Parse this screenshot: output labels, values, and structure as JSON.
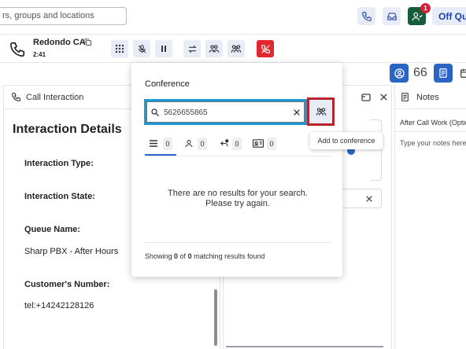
{
  "topbar": {
    "search_placeholder": "rs, groups and locations",
    "notification_count": "1",
    "status_label": "Off Que"
  },
  "call": {
    "name": "Redondo CA",
    "duration": "2:41"
  },
  "toolbar": {
    "count_66": "66"
  },
  "call_interaction": {
    "header": "Call Interaction",
    "title": "Interaction Details",
    "fields": [
      {
        "label": "Interaction Type:",
        "value": ""
      },
      {
        "label": "Interaction State:",
        "value": ""
      },
      {
        "label": "Queue Name:",
        "value": "Sharp PBX - After Hours"
      },
      {
        "label": "Customer's Number:",
        "value": "tel:+14242128126"
      }
    ]
  },
  "notes": {
    "header": "Notes",
    "after_call_work": "After Call Work (Optio",
    "placeholder": "Type your notes here"
  },
  "conference": {
    "title": "Conference",
    "search_value": "5626655865",
    "add_tooltip": "Add to conference",
    "tabs": [
      {
        "icon": "list-icon",
        "count": "0"
      },
      {
        "icon": "person-icon",
        "count": "0"
      },
      {
        "icon": "call-queue-icon",
        "count": "0"
      },
      {
        "icon": "contact-card-icon",
        "count": "0"
      }
    ],
    "no_results_line1": "There are no results for your search.",
    "no_results_line2": "Please try again.",
    "footer_prefix": "Showing ",
    "footer_shown": "0",
    "footer_of": " of ",
    "footer_total": "0",
    "footer_suffix": " matching results found"
  },
  "colors": {
    "accent_blue": "#2a64c4",
    "highlight_cyan": "#1b9ad6",
    "highlight_red": "#b5252b",
    "end_call_red": "#e0282e",
    "agent_green": "#145c3a"
  }
}
